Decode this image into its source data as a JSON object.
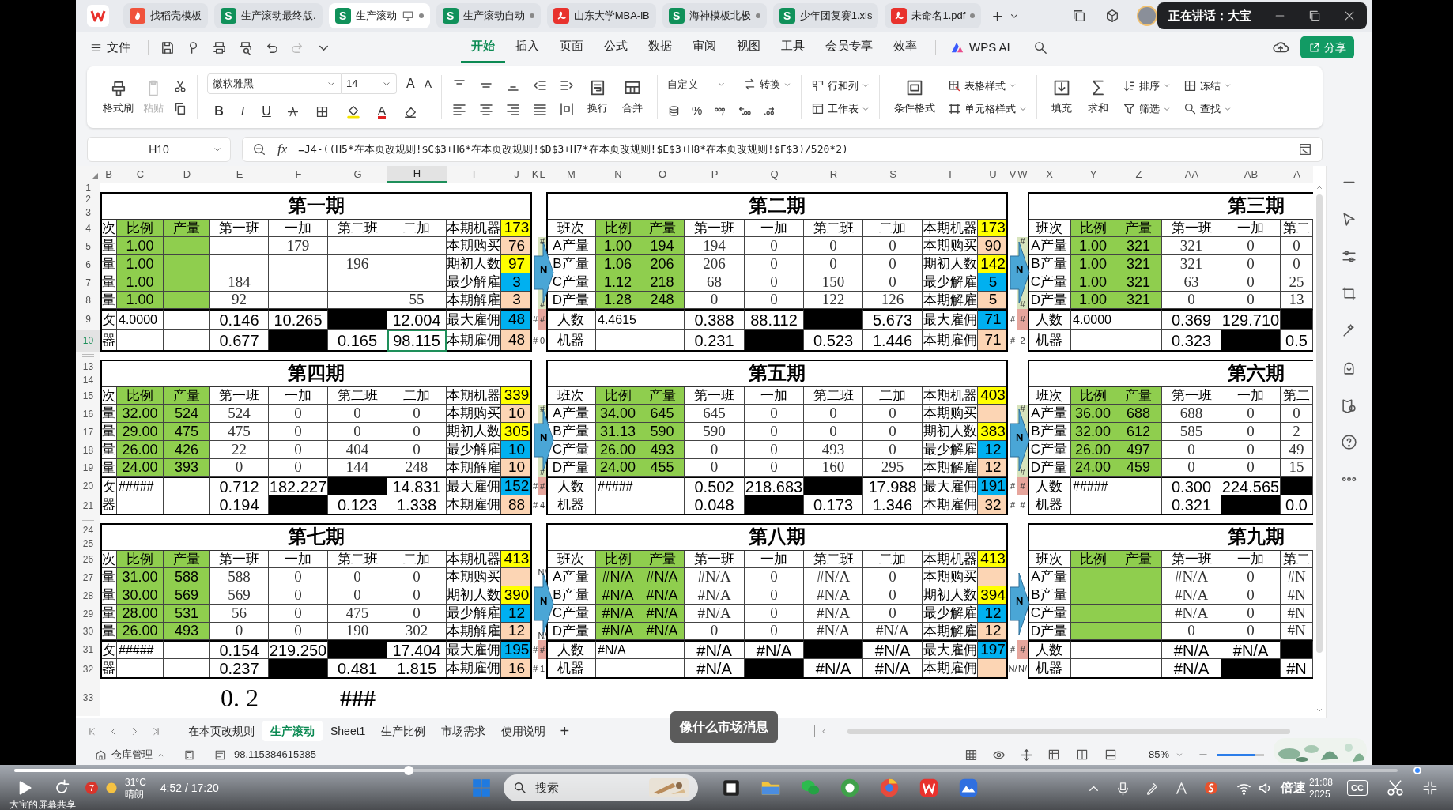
{
  "app_tabs": [
    {
      "kind": "docer",
      "label": "找稻壳模板",
      "selected": false,
      "unsaved": false,
      "sharing": false
    },
    {
      "kind": "sheet",
      "icon_letter": "S",
      "label": "生产滚动最终版.",
      "selected": false,
      "unsaved": false,
      "sharing": false
    },
    {
      "kind": "sheet",
      "icon_letter": "S",
      "label": "生产滚动",
      "selected": true,
      "unsaved": true,
      "sharing": true
    },
    {
      "kind": "sheet",
      "icon_letter": "S",
      "label": "生产滚动自动",
      "selected": false,
      "unsaved": true,
      "sharing": false
    },
    {
      "kind": "pdf",
      "label": "山东大学MBA-iB",
      "selected": false,
      "unsaved": false,
      "sharing": false
    },
    {
      "kind": "sheet",
      "icon_letter": "S",
      "label": "海神模板北极",
      "selected": false,
      "unsaved": true,
      "sharing": false
    },
    {
      "kind": "sheet",
      "icon_letter": "S",
      "label": "少年团复赛1.xls",
      "selected": false,
      "unsaved": false,
      "sharing": false
    },
    {
      "kind": "pdf",
      "label": "未命名1.pdf",
      "selected": false,
      "unsaved": true,
      "sharing": false
    }
  ],
  "speaking": "正在讲话：大宝",
  "menu": {
    "file": "文件",
    "tabs": [
      {
        "label": "开始",
        "selected": true
      },
      {
        "label": "插入",
        "selected": false
      },
      {
        "label": "页面",
        "selected": false
      },
      {
        "label": "公式",
        "selected": false
      },
      {
        "label": "数据",
        "selected": false
      },
      {
        "label": "审阅",
        "selected": false
      },
      {
        "label": "视图",
        "selected": false
      },
      {
        "label": "工具",
        "selected": false
      },
      {
        "label": "会员专享",
        "selected": false
      },
      {
        "label": "效率",
        "selected": false
      }
    ],
    "ai": "WPS AI",
    "share": "分享"
  },
  "ribbon": {
    "format_painter": "格式刷",
    "paste": {
      "label": "粘贴",
      "disabled": true
    },
    "font": "微软雅黑",
    "font_size": "14",
    "grow": "A",
    "shrink": "A",
    "styles": [
      "B",
      "I",
      "U"
    ],
    "font_color": "A",
    "wrap": "换行",
    "merge": "合并",
    "number_format": "自定义",
    "convert": "转换",
    "percent": "%",
    "rows_cols": "行和列",
    "worksheet": "工作表",
    "cond_format": "条件格式",
    "table_style": "表格样式",
    "cell_style": "单元格样式",
    "fill": "填充",
    "sum": "求和",
    "sort": "排序",
    "filter": "筛选",
    "freeze": "冻结",
    "find": "查找"
  },
  "name_box": "H10",
  "fx": "fx",
  "formula": "=J4-((H5*在本页改规则!$C$3+H6*在本页改规则!$D$3+H7*在本页改规则!$E$3+H8*在本页改规则!$F$3)/520*2)",
  "sheet": {
    "columns": [
      {
        "label": "B",
        "selected": false
      },
      {
        "label": "C",
        "selected": false
      },
      {
        "label": "D",
        "selected": false
      },
      {
        "label": "E",
        "selected": false
      },
      {
        "label": "F",
        "selected": false
      },
      {
        "label": "G",
        "selected": false
      },
      {
        "label": "H",
        "selected": true
      },
      {
        "label": "I",
        "selected": false
      },
      {
        "label": "J",
        "selected": false
      },
      {
        "label": "K",
        "selected": false
      },
      {
        "label": "L",
        "selected": false
      },
      {
        "label": "M",
        "selected": false
      },
      {
        "label": "N",
        "selected": false
      },
      {
        "label": "O",
        "selected": false
      },
      {
        "label": "P",
        "selected": false
      },
      {
        "label": "Q",
        "selected": false
      },
      {
        "label": "R",
        "selected": false
      },
      {
        "label": "S",
        "selected": false
      },
      {
        "label": "T",
        "selected": false
      },
      {
        "label": "U",
        "selected": false
      },
      {
        "label": "V",
        "selected": false
      },
      {
        "label": "W",
        "selected": false
      },
      {
        "label": "X",
        "selected": false
      },
      {
        "label": "Y",
        "selected": false
      },
      {
        "label": "Z",
        "selected": false
      },
      {
        "label": "AA",
        "selected": false
      },
      {
        "label": "AB",
        "selected": false
      },
      {
        "label": "A",
        "selected": false
      }
    ],
    "rows": [
      {
        "label": "1",
        "selected": false
      },
      {
        "label": "2",
        "selected": false
      },
      {
        "label": "3",
        "selected": false
      },
      {
        "label": "4",
        "selected": false
      },
      {
        "label": "5",
        "selected": false
      },
      {
        "label": "6",
        "selected": false
      },
      {
        "label": "7",
        "selected": false
      },
      {
        "label": "8",
        "selected": false
      },
      {
        "label": "9",
        "selected": false
      },
      {
        "label": "10",
        "selected": true
      },
      {
        "label": "13",
        "selected": false
      },
      {
        "label": "14",
        "selected": false
      },
      {
        "label": "15",
        "selected": false
      },
      {
        "label": "16",
        "selected": false
      },
      {
        "label": "17",
        "selected": false
      },
      {
        "label": "18",
        "selected": false
      },
      {
        "label": "19",
        "selected": false
      },
      {
        "label": "20",
        "selected": false
      },
      {
        "label": "21",
        "selected": false
      },
      {
        "label": "24",
        "selected": false
      },
      {
        "label": "25",
        "selected": false
      },
      {
        "label": "26",
        "selected": false
      },
      {
        "label": "27",
        "selected": false
      },
      {
        "label": "28",
        "selected": false
      },
      {
        "label": "29",
        "selected": false
      },
      {
        "label": "30",
        "selected": false
      },
      {
        "label": "31",
        "selected": false
      },
      {
        "label": "32",
        "selected": false
      },
      {
        "label": "33",
        "selected": false
      }
    ],
    "bands": [
      {
        "blocks": [
          {
            "title": "第一期",
            "columns": [
              "次",
              "比例",
              "产量",
              "第一班",
              "一加",
              "第二班",
              "二加"
            ],
            "rows": [
              {
                "kind": "product",
                "label": "量",
                "ratio": "1.00",
                "extra1": "179"
              },
              {
                "kind": "product",
                "label": "量",
                "ratio": "1.00",
                "shift2": "196"
              },
              {
                "kind": "product",
                "label": "量",
                "ratio": "1.00",
                "shift1": "184"
              },
              {
                "kind": "product",
                "label": "量",
                "ratio": "1.00",
                "shift1": "92",
                "extra2": "55"
              },
              {
                "kind": "people",
                "label": "攵",
                "ratio": "4.0000",
                "shift1": "0.146",
                "extra1": "10.265",
                "extra2": "12.004",
                "shift2_shaded": true
              },
              {
                "kind": "machine",
                "label": "器",
                "shift1": "0.677",
                "shift2": "0.165",
                "extra2": "98.115",
                "extra1_shaded": true
              }
            ],
            "side": [
              {
                "label": "本期机器",
                "value": "173",
                "color": "#ffff00"
              },
              {
                "label": "本期购买",
                "value": "76",
                "color": "#fcd5b4"
              },
              {
                "label": "期初人数",
                "value": "97",
                "color": "#ffff00"
              },
              {
                "label": "最少解雇",
                "value": "3",
                "color": "#00b0f0"
              },
              {
                "label": "本期解雇",
                "value": "3",
                "color": "#fcd5b4"
              },
              {
                "label": "最大雇佣",
                "value": "48",
                "color": "#00b0f0"
              },
              {
                "label": "本期雇佣",
                "value": "48",
                "color": "#fcd5b4"
              }
            ]
          },
          {
            "title": "第二期",
            "columns": [
              "班次",
              "比例",
              "产量",
              "第一班",
              "一加",
              "第二班",
              "二加"
            ],
            "rows": [
              {
                "kind": "product",
                "label": "A产量",
                "ratio": "1.00",
                "output": "194",
                "shift1": "194",
                "extra1": "0",
                "shift2": "0",
                "extra2": "0"
              },
              {
                "kind": "product",
                "label": "B产量",
                "ratio": "1.06",
                "output": "206",
                "shift1": "206",
                "extra1": "0",
                "shift2": "0",
                "extra2": "0"
              },
              {
                "kind": "product",
                "label": "C产量",
                "ratio": "1.12",
                "output": "218",
                "shift1": "68",
                "extra1": "0",
                "shift2": "150",
                "extra2": "0"
              },
              {
                "kind": "product",
                "label": "D产量",
                "ratio": "1.28",
                "output": "248",
                "shift1": "0",
                "extra1": "0",
                "shift2": "122",
                "extra2": "126"
              },
              {
                "kind": "people",
                "label": "人数",
                "ratio": "4.4615",
                "shift1": "0.388",
                "extra1": "88.112",
                "extra2": "5.673",
                "shift2_shaded": true
              },
              {
                "kind": "machine",
                "label": "机器",
                "shift1": "0.231",
                "shift2": "0.523",
                "extra2": "1.446",
                "extra1_shaded": true
              }
            ],
            "side": [
              {
                "label": "本期机器",
                "value": "173",
                "color": "#ffff00"
              },
              {
                "label": "本期购买",
                "value": "90",
                "color": "#fcd5b4"
              },
              {
                "label": "期初人数",
                "value": "142",
                "color": "#ffff00"
              },
              {
                "label": "最少解雇",
                "value": "5",
                "color": "#00b0f0"
              },
              {
                "label": "本期解雇",
                "value": "5",
                "color": "#fcd5b4"
              },
              {
                "label": "最大雇佣",
                "value": "71",
                "color": "#00b0f0"
              },
              {
                "label": "本期雇佣",
                "value": "71",
                "color": "#fcd5b4"
              }
            ]
          },
          {
            "title": "第三期",
            "columns": [
              "班次",
              "比例",
              "产量",
              "第一班",
              "一加",
              "第二"
            ],
            "rows": [
              {
                "kind": "product",
                "label": "A产量",
                "ratio": "1.00",
                "output": "321",
                "shift1": "321",
                "extra1": "0",
                "shift2": "0"
              },
              {
                "kind": "product",
                "label": "B产量",
                "ratio": "1.00",
                "output": "321",
                "shift1": "321",
                "extra1": "0",
                "shift2": "0"
              },
              {
                "kind": "product",
                "label": "C产量",
                "ratio": "1.00",
                "output": "321",
                "shift1": "63",
                "extra1": "0",
                "shift2": "25"
              },
              {
                "kind": "product",
                "label": "D产量",
                "ratio": "1.00",
                "output": "321",
                "shift1": "0",
                "extra1": "0",
                "shift2": "13"
              },
              {
                "kind": "people",
                "label": "人数",
                "ratio": "4.0000",
                "shift1": "0.369",
                "extra1": "129.710",
                "shift2_shaded": true
              },
              {
                "kind": "machine",
                "label": "机器",
                "shift1": "0.323",
                "shift2": "0.5",
                "extra1_shaded": true
              }
            ]
          }
        ],
        "gaps": [
          {
            "arrow": "N",
            "highlight": true,
            "top_mark": "#",
            "bottom_mark": "#",
            "people": [
              "#",
              "#"
            ],
            "machine": [
              "#",
              "0"
            ]
          },
          {
            "arrow": "N",
            "highlight": true,
            "top_mark": "#",
            "bottom_mark": "#",
            "people": [
              "#",
              "#"
            ],
            "machine": [
              "#",
              "2"
            ]
          }
        ]
      },
      {
        "blocks": [
          {
            "title": "第四期",
            "columns": [
              "次",
              "比例",
              "产量",
              "第一班",
              "一加",
              "第二班",
              "二加"
            ],
            "rows": [
              {
                "kind": "product",
                "label": "量",
                "ratio": "32.00",
                "output": "524",
                "shift1": "524",
                "extra1": "0",
                "shift2": "0",
                "extra2": "0"
              },
              {
                "kind": "product",
                "label": "量",
                "ratio": "29.00",
                "output": "475",
                "shift1": "475",
                "extra1": "0",
                "shift2": "0",
                "extra2": "0"
              },
              {
                "kind": "product",
                "label": "量",
                "ratio": "26.00",
                "output": "426",
                "shift1": "22",
                "extra1": "0",
                "shift2": "404",
                "extra2": "0"
              },
              {
                "kind": "product",
                "label": "量",
                "ratio": "24.00",
                "output": "393",
                "shift1": "0",
                "extra1": "0",
                "shift2": "144",
                "extra2": "248"
              },
              {
                "kind": "people",
                "label": "攵",
                "ratio": "#####",
                "shift1": "0.712",
                "extra1": "182.227",
                "extra2": "14.831",
                "shift2_shaded": true
              },
              {
                "kind": "machine",
                "label": "器",
                "shift1": "0.194",
                "shift2": "0.123",
                "extra2": "1.338",
                "extra1_shaded": true
              }
            ],
            "side": [
              {
                "label": "本期机器",
                "value": "339",
                "color": "#ffff00"
              },
              {
                "label": "本期购买",
                "value": "10",
                "color": "#fcd5b4"
              },
              {
                "label": "期初人数",
                "value": "305",
                "color": "#ffff00"
              },
              {
                "label": "最少解雇",
                "value": "10",
                "color": "#00b0f0"
              },
              {
                "label": "本期解雇",
                "value": "10",
                "color": "#fcd5b4"
              },
              {
                "label": "最大雇佣",
                "value": "152",
                "color": "#00b0f0"
              },
              {
                "label": "本期雇佣",
                "value": "88",
                "color": "#fcd5b4"
              }
            ]
          },
          {
            "title": "第五期",
            "columns": [
              "班次",
              "比例",
              "产量",
              "第一班",
              "一加",
              "第二班",
              "二加"
            ],
            "rows": [
              {
                "kind": "product",
                "label": "A产量",
                "ratio": "34.00",
                "output": "645",
                "shift1": "645",
                "extra1": "0",
                "shift2": "0",
                "extra2": "0"
              },
              {
                "kind": "product",
                "label": "B产量",
                "ratio": "31.13",
                "output": "590",
                "shift1": "590",
                "extra1": "0",
                "shift2": "0",
                "extra2": "0"
              },
              {
                "kind": "product",
                "label": "C产量",
                "ratio": "26.00",
                "output": "493",
                "shift1": "0",
                "extra1": "0",
                "shift2": "493",
                "extra2": "0"
              },
              {
                "kind": "product",
                "label": "D产量",
                "ratio": "24.00",
                "output": "455",
                "shift1": "0",
                "extra1": "0",
                "shift2": "160",
                "extra2": "295"
              },
              {
                "kind": "people",
                "label": "人数",
                "ratio": "#####",
                "shift1": "0.502",
                "extra1": "218.683",
                "extra2": "17.988",
                "shift2_shaded": true
              },
              {
                "kind": "machine",
                "label": "机器",
                "shift1": "0.048",
                "shift2": "0.173",
                "extra2": "1.346",
                "extra1_shaded": true
              }
            ],
            "side": [
              {
                "label": "本期机器",
                "value": "403",
                "color": "#ffff00"
              },
              {
                "label": "本期购买",
                "color": "#fcd5b4"
              },
              {
                "label": "期初人数",
                "value": "383",
                "color": "#ffff00"
              },
              {
                "label": "最少解雇",
                "value": "12",
                "color": "#00b0f0"
              },
              {
                "label": "本期解雇",
                "value": "12",
                "color": "#fcd5b4"
              },
              {
                "label": "最大雇佣",
                "value": "191",
                "color": "#00b0f0"
              },
              {
                "label": "本期雇佣",
                "value": "32",
                "color": "#fcd5b4"
              }
            ]
          },
          {
            "title": "第六期",
            "columns": [
              "班次",
              "比例",
              "产量",
              "第一班",
              "一加",
              "第二"
            ],
            "rows": [
              {
                "kind": "product",
                "label": "A产量",
                "ratio": "36.00",
                "output": "688",
                "shift1": "688",
                "extra1": "0",
                "shift2": "0"
              },
              {
                "kind": "product",
                "label": "B产量",
                "ratio": "32.00",
                "output": "612",
                "shift1": "585",
                "extra1": "0",
                "shift2": "2"
              },
              {
                "kind": "product",
                "label": "C产量",
                "ratio": "26.00",
                "output": "497",
                "shift1": "0",
                "extra1": "0",
                "shift2": "49"
              },
              {
                "kind": "product",
                "label": "D产量",
                "ratio": "24.00",
                "output": "459",
                "shift1": "0",
                "extra1": "0",
                "shift2": "15"
              },
              {
                "kind": "people",
                "label": "人数",
                "ratio": "#####",
                "shift1": "0.300",
                "extra1": "224.565",
                "shift2_shaded": true
              },
              {
                "kind": "machine",
                "label": "机器",
                "shift1": "0.321",
                "shift2": "0.0",
                "extra1_shaded": true
              }
            ]
          }
        ],
        "gaps": [
          {
            "arrow": "N",
            "highlight": true,
            "top_mark": "#",
            "bottom_mark": "#",
            "people": [
              "#",
              "#"
            ],
            "machine": [
              "#",
              "4"
            ]
          },
          {
            "arrow": "N",
            "highlight": true,
            "top_mark": "#",
            "bottom_mark": "#",
            "people": [
              "#",
              "#"
            ],
            "machine": [
              "#",
              "#"
            ]
          }
        ]
      },
      {
        "blocks": [
          {
            "title": "第七期",
            "columns": [
              "次",
              "比例",
              "产量",
              "第一班",
              "一加",
              "第二班",
              "二加"
            ],
            "rows": [
              {
                "kind": "product",
                "label": "量",
                "ratio": "31.00",
                "output": "588",
                "shift1": "588",
                "extra1": "0",
                "shift2": "0",
                "extra2": "0"
              },
              {
                "kind": "product",
                "label": "量",
                "ratio": "30.00",
                "output": "569",
                "shift1": "569",
                "extra1": "0",
                "shift2": "0",
                "extra2": "0"
              },
              {
                "kind": "product",
                "label": "量",
                "ratio": "28.00",
                "output": "531",
                "shift1": "56",
                "extra1": "0",
                "shift2": "475",
                "extra2": "0"
              },
              {
                "kind": "product",
                "label": "量",
                "ratio": "26.00",
                "output": "493",
                "shift1": "0",
                "extra1": "0",
                "shift2": "190",
                "extra2": "302"
              },
              {
                "kind": "people",
                "label": "攵",
                "ratio": "#####",
                "shift1": "0.154",
                "extra1": "219.250",
                "extra2": "17.404",
                "shift2_shaded": true
              },
              {
                "kind": "machine",
                "label": "器",
                "shift1": "0.237",
                "shift2": "0.481",
                "extra2": "1.815",
                "extra1_shaded": true
              }
            ],
            "side": [
              {
                "label": "本期机器",
                "value": "413",
                "color": "#ffff00"
              },
              {
                "label": "本期购买",
                "color": "#fcd5b4"
              },
              {
                "label": "期初人数",
                "value": "390",
                "color": "#ffff00"
              },
              {
                "label": "最少解雇",
                "value": "12",
                "color": "#00b0f0"
              },
              {
                "label": "本期解雇",
                "value": "12",
                "color": "#fcd5b4"
              },
              {
                "label": "最大雇佣",
                "value": "195",
                "color": "#00b0f0"
              },
              {
                "label": "本期雇佣",
                "value": "16",
                "color": "#fcd5b4"
              }
            ]
          },
          {
            "title": "第八期",
            "columns": [
              "班次",
              "比例",
              "产量",
              "第一班",
              "一加",
              "第二班",
              "二加"
            ],
            "rows": [
              {
                "kind": "product",
                "label": "A产量",
                "ratio": "#N/A",
                "output": "#N/A",
                "shift1": "#N/A",
                "extra1": "0",
                "shift2": "#N/A",
                "extra2": "0"
              },
              {
                "kind": "product",
                "label": "B产量",
                "ratio": "#N/A",
                "output": "#N/A",
                "shift1": "#N/A",
                "extra1": "0",
                "shift2": "#N/A",
                "extra2": "0"
              },
              {
                "kind": "product",
                "label": "C产量",
                "ratio": "#N/A",
                "output": "#N/A",
                "shift1": "#N/A",
                "extra1": "0",
                "shift2": "#N/A",
                "extra2": "0"
              },
              {
                "kind": "product",
                "label": "D产量",
                "ratio": "#N/A",
                "output": "#N/A",
                "shift1": "0",
                "extra1": "0",
                "shift2": "#N/A",
                "extra2": "#N/A"
              },
              {
                "kind": "people",
                "label": "人数",
                "ratio": "#N/A",
                "shift1": "#N/A",
                "extra1": "#N/A",
                "extra2": "#N/A",
                "shift2_shaded": true
              },
              {
                "kind": "machine",
                "label": "机器",
                "shift1": "#N/A",
                "shift2": "#N/A",
                "extra2": "#N/A",
                "extra1_shaded": true
              }
            ],
            "side": [
              {
                "label": "本期机器",
                "value": "413",
                "color": "#ffff00"
              },
              {
                "label": "本期购买",
                "color": "#fcd5b4"
              },
              {
                "label": "期初人数",
                "value": "394",
                "color": "#ffff00"
              },
              {
                "label": "最少解雇",
                "value": "12",
                "color": "#00b0f0"
              },
              {
                "label": "本期解雇",
                "value": "12",
                "color": "#fcd5b4"
              },
              {
                "label": "最大雇佣",
                "value": "197",
                "color": "#00b0f0"
              },
              {
                "label": "本期雇佣",
                "color": "#fcd5b4"
              }
            ]
          },
          {
            "title": "第九期",
            "columns": [
              "班次",
              "比例",
              "产量",
              "第一班",
              "一加",
              "第二"
            ],
            "rows": [
              {
                "kind": "product",
                "label": "A产量",
                "shift1": "#N/A",
                "extra1": "0",
                "shift2": "#N"
              },
              {
                "kind": "product",
                "label": "B产量",
                "shift1": "#N/A",
                "extra1": "0",
                "shift2": "#N"
              },
              {
                "kind": "product",
                "label": "C产量",
                "shift1": "#N/A",
                "extra1": "0",
                "shift2": "#N"
              },
              {
                "kind": "product",
                "label": "D产量",
                "shift1": "0",
                "extra1": "0",
                "shift2": "#N"
              },
              {
                "kind": "people",
                "label": "人数",
                "shift1": "#N/A",
                "extra1": "#N/A",
                "shift2_shaded": true
              },
              {
                "kind": "machine",
                "label": "机器",
                "shift1": "#N/A",
                "shift2": "#N",
                "extra1_shaded": true
              }
            ]
          }
        ],
        "gaps": [
          {
            "arrow": "N",
            "highlight": false,
            "top_mark": "N/",
            "bottom_mark": "N/",
            "people": [
              "#",
              "#"
            ],
            "machine": [
              "#",
              "1"
            ]
          },
          {
            "arrow": "N",
            "highlight": false,
            "people": [
              "#",
              "#"
            ],
            "machine": [
              "N/",
              "N/"
            ]
          }
        ]
      }
    ],
    "footer": [
      "0. 2",
      "###"
    ]
  },
  "sheet_tabs": [
    {
      "label": "在本页改规则",
      "selected": false
    },
    {
      "label": "生产滚动",
      "selected": true
    },
    {
      "label": "Sheet1",
      "selected": false
    },
    {
      "label": "生产比例",
      "selected": false
    },
    {
      "label": "市场需求",
      "selected": false
    },
    {
      "label": "使用说明",
      "selected": false
    }
  ],
  "add_sheet": "+",
  "toast": "像什么市场消息",
  "status": {
    "warehouse": "仓库管理",
    "value": "98.115384615385",
    "zoom": "85%",
    "zoom_slider": {
      "level": 0.8
    }
  },
  "player": {
    "level": 0.285,
    "time": "4:52 / 17:20",
    "temperature": "31°C",
    "weather": "晴朗",
    "badge": "7",
    "search": "搜索",
    "speed": "倍速",
    "clock": "21:08",
    "date": "2025",
    "cc": "CC",
    "share_label": "大宝的屏幕共享"
  }
}
